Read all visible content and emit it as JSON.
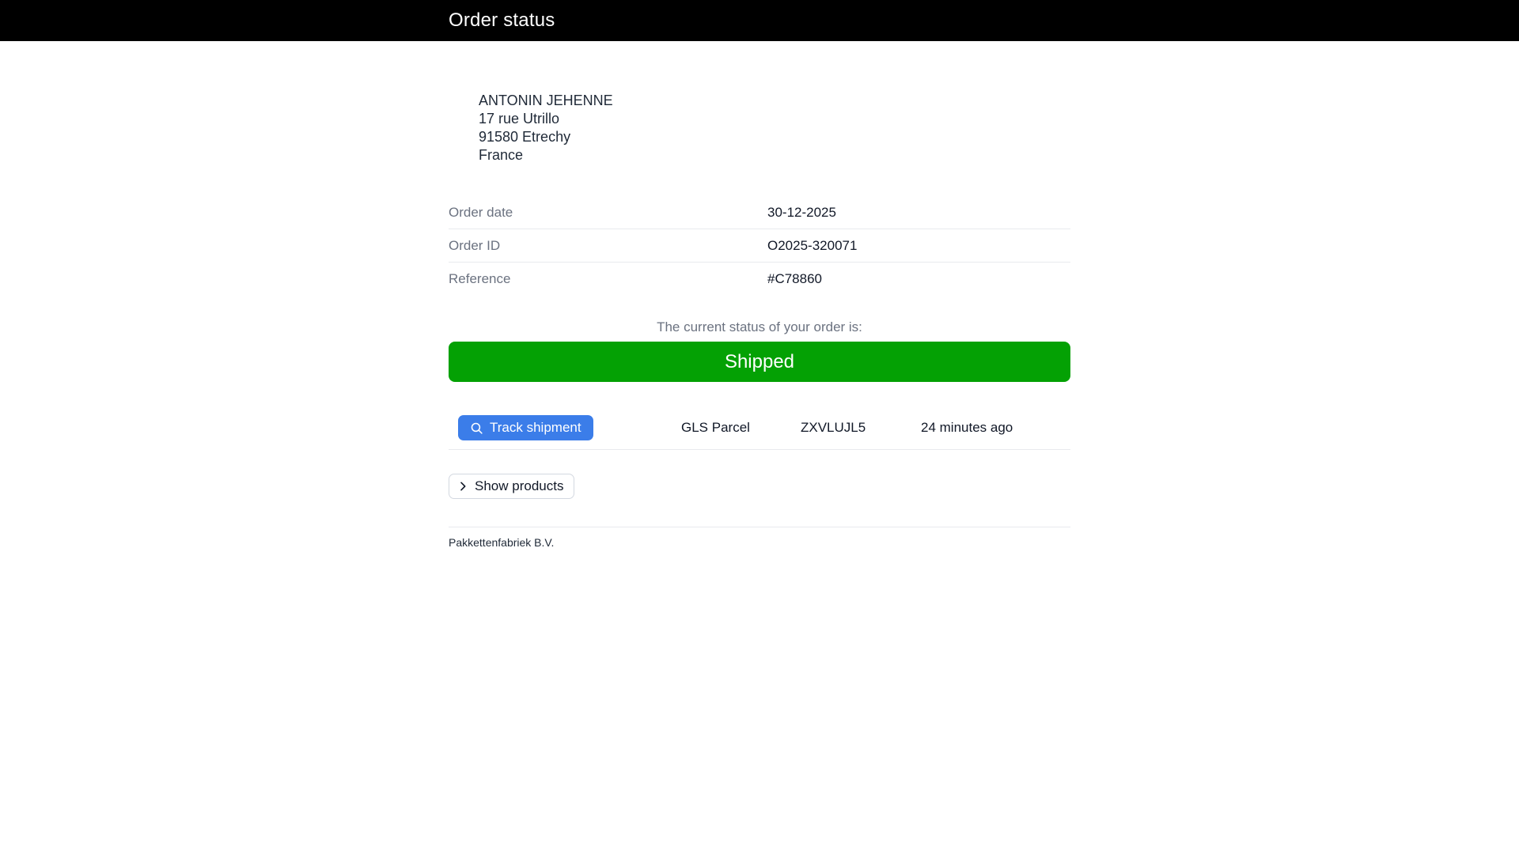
{
  "header": {
    "title": "Order status"
  },
  "recipient": {
    "lines": [
      "ANTONIN JEHENNE",
      "17 rue Utrillo",
      "91580 Etrechy",
      "France"
    ]
  },
  "details": {
    "rows": [
      {
        "label": "Order date",
        "value": "30-12-2025"
      },
      {
        "label": "Order ID",
        "value": "O2025-320071"
      },
      {
        "label": "Reference",
        "value": "#C78860"
      }
    ]
  },
  "status": {
    "intro": "The current status of your order is:",
    "value": "Shipped",
    "color": "#04a104",
    "text_color": "#ffffff"
  },
  "shipment": {
    "track_label": "Track shipment",
    "carrier": "GLS Parcel",
    "tracking_code": "ZXVLUJL5",
    "time_ago": "24 minutes ago",
    "button_color": "#3b7de9"
  },
  "products": {
    "toggle_label": "Show products"
  },
  "footer": {
    "company": "Pakkettenfabriek B.V."
  },
  "icons": {
    "search": "search-icon",
    "chevron": "chevron-right-icon"
  }
}
